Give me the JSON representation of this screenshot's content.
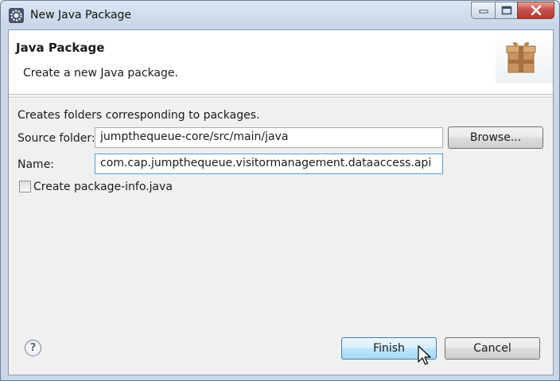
{
  "window": {
    "title": "New Java Package",
    "icons": {
      "app": "eclipse-gear-icon",
      "minimize": "minimize-icon",
      "maximize": "maximize-icon",
      "close": "close-icon"
    }
  },
  "banner": {
    "title": "Java Package",
    "subtitle": "Create a new Java package.",
    "image_icon": "package-box-icon"
  },
  "form": {
    "description": "Creates folders corresponding to packages.",
    "source_folder_label": "Source folder:",
    "source_folder_value": "jumpthequeue-core/src/main/java",
    "browse_label": "Browse...",
    "name_label": "Name:",
    "name_value": "com.cap.jumpthequeue.visitormanagement.dataaccess.api",
    "package_info_label": "Create package-info.java",
    "package_info_checked": false
  },
  "footer": {
    "help_icon": "help-icon",
    "help_glyph": "?",
    "finish_label": "Finish",
    "cancel_label": "Cancel"
  },
  "colors": {
    "title_bar": "#c6d5e7",
    "close_button": "#c75050",
    "default_button": "#bee6fd",
    "dialog_background": "#f0f0f0"
  }
}
